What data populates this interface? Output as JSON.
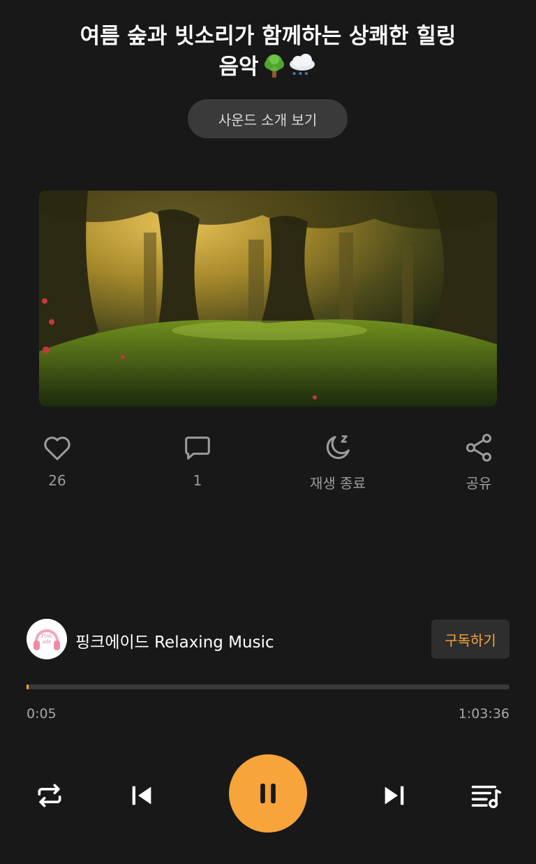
{
  "track": {
    "title_line1": "여름 숲과 빗소리가 함께하는 상쾌한 힐링",
    "title_line2": "음악",
    "title_emojis": [
      "tree-emoji",
      "snow-cloud-emoji"
    ]
  },
  "intro_button": {
    "label": "사운드 소개 보기"
  },
  "cover": {
    "icon": "forest-cover-image"
  },
  "actions": {
    "like": {
      "icon": "heart-icon",
      "label": "26"
    },
    "comment": {
      "icon": "comment-icon",
      "label": "1"
    },
    "sleep": {
      "icon": "moon-sleep-icon",
      "label": "재생 종료"
    },
    "share": {
      "icon": "share-icon",
      "label": "공유"
    }
  },
  "channel": {
    "name": "핑크에이드 Relaxing Music",
    "avatar_icon": "pink-headphones-avatar",
    "subscribe_label": "구독하기"
  },
  "playback": {
    "progress": 0.001,
    "current_time": "0:05",
    "total_time": "1:03:36"
  },
  "controls": {
    "repeat": "repeat-icon",
    "previous": "skip-previous-icon",
    "pause": "pause-icon",
    "next": "skip-next-icon",
    "playlist": "playlist-icon"
  },
  "colors": {
    "background": "#181818",
    "accent": "#f7a43a",
    "muted_text": "#9c9c9c",
    "button_bg": "#3a3a3a"
  }
}
